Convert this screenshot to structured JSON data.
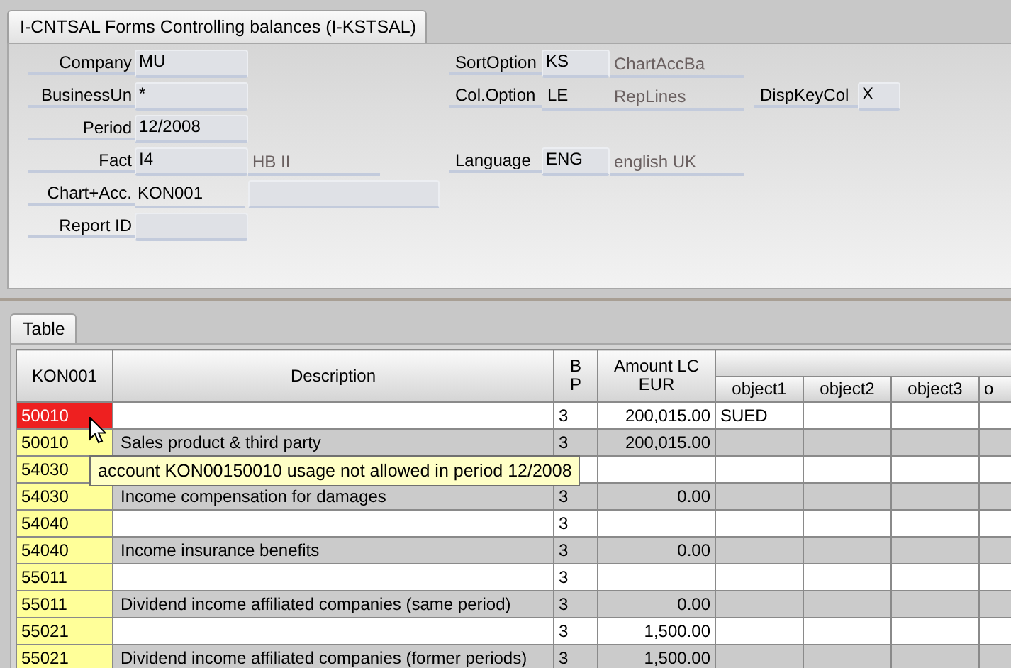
{
  "form_tab": {
    "label": "I-CNTSAL Forms Controlling balances (I-KSTSAL)",
    "selected": true
  },
  "form_rows": [
    {
      "fields": [
        {
          "label": "Company",
          "value": "MU",
          "kind": "input"
        },
        {
          "label": "SortOption",
          "value": "KS",
          "kind": "input",
          "description": "ChartAccBa"
        }
      ]
    },
    {
      "fields": [
        {
          "label": "BusinessUn",
          "value": "*",
          "kind": "input"
        },
        {
          "label": "Col.Option",
          "value": "LE",
          "kind": "text",
          "description": "RepLines"
        },
        {
          "label": "DispKeyCol",
          "value": "X",
          "kind": "input"
        }
      ]
    },
    {
      "fields": [
        {
          "label": "Period",
          "value": "12/2008",
          "kind": "input"
        }
      ]
    },
    {
      "fields": [
        {
          "label": "Fact",
          "value": "I4",
          "kind": "input",
          "description": "HB II"
        },
        {
          "label": "Language",
          "value": "ENG",
          "kind": "input",
          "description": "english UK"
        }
      ]
    },
    {
      "fields": [
        {
          "label": "Chart+Acc.",
          "value": "KON001",
          "kind": "text",
          "description_field": true
        }
      ]
    },
    {
      "fields": [
        {
          "label": "Report ID",
          "kind": "input"
        }
      ]
    }
  ],
  "table_tab": {
    "label": "Table",
    "selected": true
  },
  "table": {
    "columns": [
      "KON001",
      "Description",
      "B P",
      "Amount LC EUR"
    ],
    "object_columns": [
      "object1",
      "object2",
      "object3",
      "o"
    ],
    "rows": [
      {
        "code": "50010",
        "error": true,
        "shaded": false,
        "bp": "3",
        "amount": "200,015.00",
        "objects": [
          "SUED"
        ]
      },
      {
        "code": "50010",
        "error": false,
        "shaded": true,
        "description": "Sales product & third party",
        "bp": "3",
        "amount": "200,015.00"
      },
      {
        "code": "54030",
        "error": false,
        "shaded": false
      },
      {
        "code": "54030",
        "error": false,
        "shaded": true,
        "description": "Income compensation for damages",
        "bp": "3",
        "amount": "0.00"
      },
      {
        "code": "54040",
        "error": false,
        "shaded": false,
        "bp": "3"
      },
      {
        "code": "54040",
        "error": false,
        "shaded": true,
        "description": "Income insurance benefits",
        "bp": "3",
        "amount": "0.00"
      },
      {
        "code": "55011",
        "error": false,
        "shaded": false,
        "bp": "3"
      },
      {
        "code": "55011",
        "error": false,
        "shaded": true,
        "description": "Dividend income affiliated companies (same period)",
        "bp": "3",
        "amount": "0.00"
      },
      {
        "code": "55021",
        "error": false,
        "shaded": false,
        "bp": "3",
        "amount": "1,500.00"
      },
      {
        "code": "55021",
        "error": false,
        "shaded": true,
        "description": "Dividend income affiliated companies (former periods)",
        "bp": "3",
        "amount": "1,500.00"
      }
    ]
  },
  "tooltip": {
    "text": "account KON00150010 usage not allowed in period 12/2008"
  }
}
